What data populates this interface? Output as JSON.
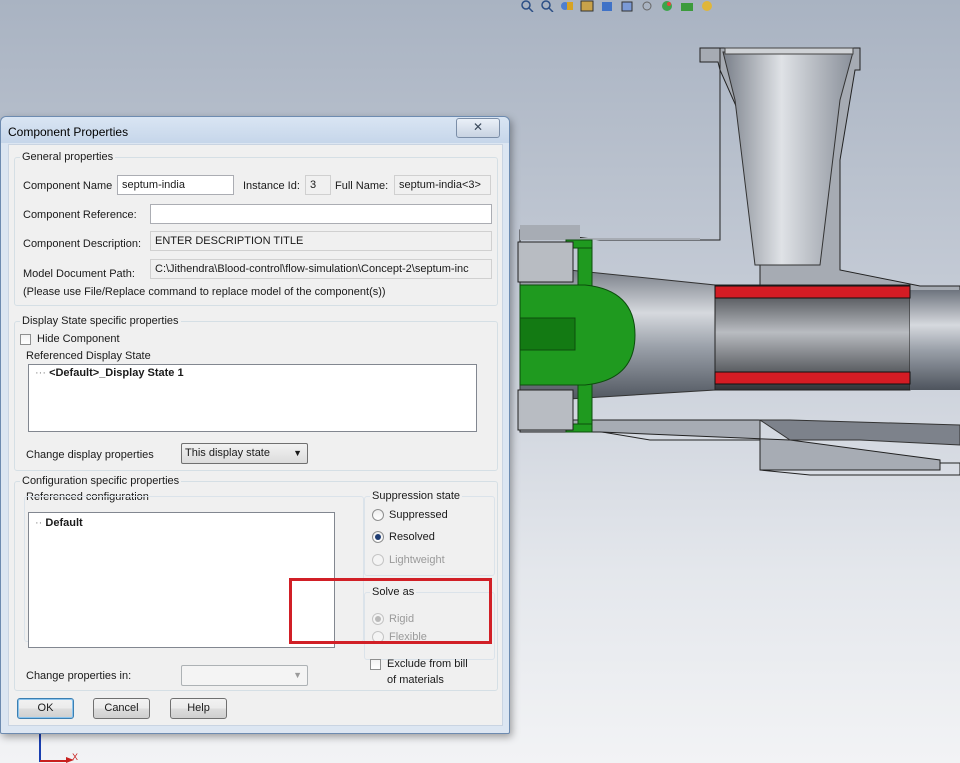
{
  "dialog": {
    "title": "Component Properties",
    "close_glyph": "✕"
  },
  "general": {
    "legend": "General properties",
    "component_name_label": "Component Name",
    "component_name_value": "septum-india",
    "instance_id_label": "Instance Id:",
    "instance_id_value": "3",
    "full_name_label": "Full Name:",
    "full_name_value": "septum-india<3>",
    "component_reference_label": "Component Reference:",
    "component_reference_value": "",
    "component_description_label": "Component Description:",
    "component_description_value": "ENTER DESCRIPTION TITLE",
    "model_path_label": "Model Document Path:",
    "model_path_value": "C:\\Jithendra\\Blood-control\\flow-simulation\\Concept-2\\septum-inc",
    "replace_note": "(Please use File/Replace command to replace model of the component(s))"
  },
  "display_state": {
    "legend": "Display State specific properties",
    "hide_component_label": "Hide Component",
    "hide_component_checked": false,
    "referenced_label": "Referenced Display State",
    "items": [
      "<Default>_Display State 1"
    ],
    "change_label": "Change display properties",
    "change_value": "This display state"
  },
  "configuration": {
    "legend": "Configuration specific properties",
    "referenced_label": "Referenced configuration",
    "items": [
      "Default"
    ],
    "change_label": "Change properties in:",
    "change_value": ""
  },
  "suppression": {
    "legend": "Suppression state",
    "options": [
      {
        "label": "Suppressed",
        "selected": false,
        "enabled": true
      },
      {
        "label": "Resolved",
        "selected": true,
        "enabled": true
      },
      {
        "label": "Lightweight",
        "selected": false,
        "enabled": false
      }
    ]
  },
  "solve_as": {
    "legend": "Solve as",
    "options": [
      {
        "label": "Rigid",
        "selected": true,
        "enabled": false
      },
      {
        "label": "Flexible",
        "selected": false,
        "enabled": false
      }
    ]
  },
  "exclude_bom": {
    "label_line1": "Exclude from bill",
    "label_line2": "of materials",
    "checked": false
  },
  "buttons": {
    "ok": "OK",
    "cancel": "Cancel",
    "help": "Help"
  },
  "triad": {
    "x_label": "X"
  },
  "colors": {
    "highlight": "#d11f26",
    "part_green": "#1f9a1f",
    "seal_red": "#d41c24",
    "section_gray": "#9ea3ab"
  }
}
